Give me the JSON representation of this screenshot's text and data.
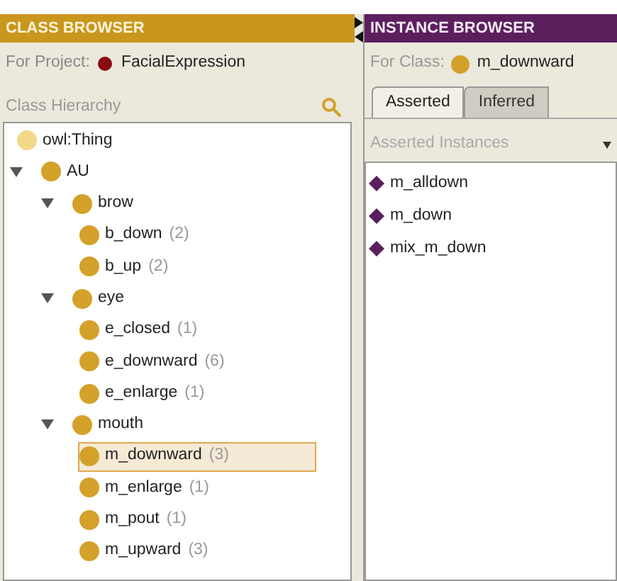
{
  "class_browser": {
    "title": "CLASS BROWSER",
    "project_label": "For Project:",
    "project_name": "FacialExpression",
    "hierarchy_label": "Class Hierarchy",
    "tree": [
      {
        "label": "owl:Thing",
        "kind": "root",
        "selected": false
      },
      {
        "label": "AU",
        "kind": "class",
        "selected": false,
        "expanded": true,
        "children": [
          {
            "label": "brow",
            "kind": "class",
            "selected": false,
            "expanded": true,
            "children": [
              {
                "label": "b_down",
                "count": "(2)",
                "kind": "class",
                "selected": false
              },
              {
                "label": "b_up",
                "count": "(2)",
                "kind": "class",
                "selected": false
              }
            ]
          },
          {
            "label": "eye",
            "kind": "class",
            "selected": false,
            "expanded": true,
            "children": [
              {
                "label": "e_closed",
                "count": "(1)",
                "kind": "class",
                "selected": false
              },
              {
                "label": "e_downward",
                "count": "(6)",
                "kind": "class",
                "selected": false
              },
              {
                "label": "e_enlarge",
                "count": "(1)",
                "kind": "class",
                "selected": false
              }
            ]
          },
          {
            "label": "mouth",
            "kind": "class",
            "selected": false,
            "expanded": true,
            "children": [
              {
                "label": "m_downward",
                "count": "(3)",
                "kind": "class",
                "selected": true
              },
              {
                "label": "m_enlarge",
                "count": "(1)",
                "kind": "class",
                "selected": false
              },
              {
                "label": "m_pout",
                "count": "(1)",
                "kind": "class",
                "selected": false
              },
              {
                "label": "m_upward",
                "count": "(3)",
                "kind": "class",
                "selected": false
              }
            ]
          }
        ]
      }
    ]
  },
  "instance_browser": {
    "title": "INSTANCE BROWSER",
    "class_label": "For Class:",
    "class_name": "m_downward",
    "tabs": [
      {
        "label": "Asserted",
        "selected": true
      },
      {
        "label": "Inferred",
        "selected": false
      }
    ],
    "list_label": "Asserted Instances",
    "instances": [
      {
        "label": "m_alldown"
      },
      {
        "label": "m_down"
      },
      {
        "label": "mix_m_down"
      }
    ]
  }
}
